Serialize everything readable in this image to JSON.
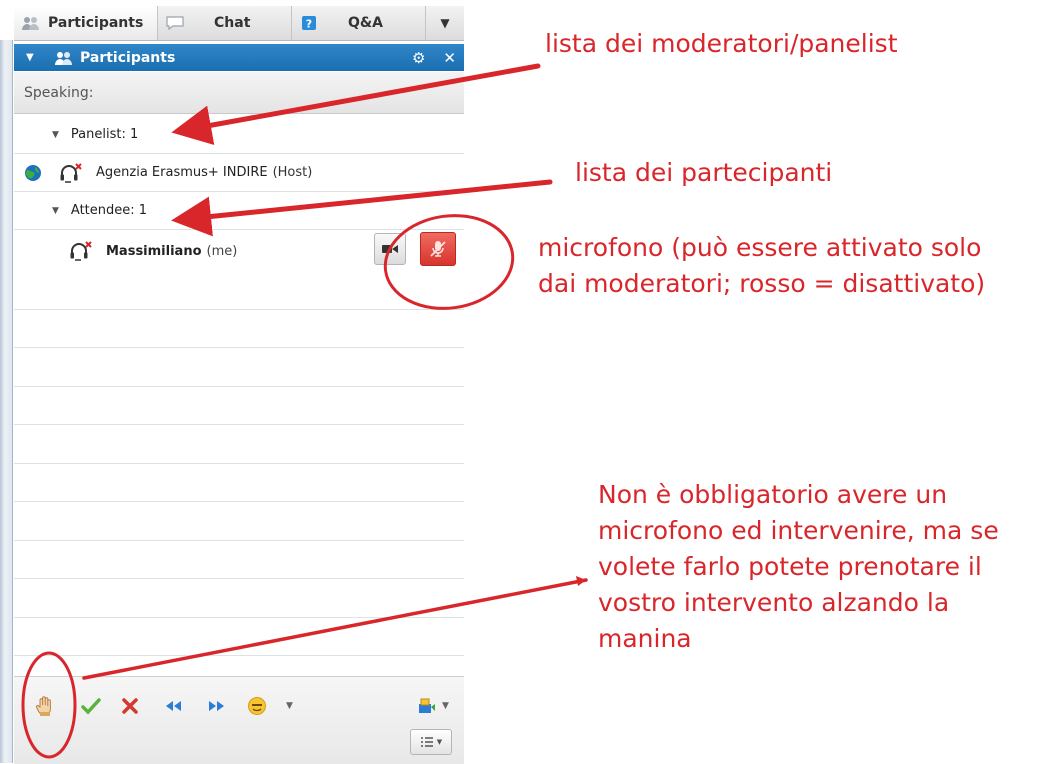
{
  "tabs": [
    {
      "label": "Participants",
      "icon": "participants-icon"
    },
    {
      "label": "Chat",
      "icon": "chat-bubble-icon"
    },
    {
      "label": "Q&A",
      "icon": "question-icon"
    }
  ],
  "panel": {
    "title": "Participants",
    "speaking_label": "Speaking:"
  },
  "groups": {
    "panelist": {
      "label": "Panelist: 1",
      "members": [
        {
          "name": "Agenzia Erasmus+ INDIRE",
          "role": "(Host)"
        }
      ]
    },
    "attendee": {
      "label": "Attendee: 1",
      "members": [
        {
          "name": "Massimiliano",
          "role": "(me)"
        }
      ]
    }
  },
  "toolbar_icons": [
    "raise-hand-icon",
    "check-icon",
    "cross-icon",
    "rewind-icon",
    "fast-forward-icon",
    "emoticon-icon",
    "share-icon",
    "list-options-icon"
  ],
  "annotations": {
    "moderators": "lista dei moderatori/panelist",
    "participants": "lista dei partecipanti",
    "microphone": "microfono (può essere attivato solo\ndai moderatori; rosso = disattivato)",
    "raise_hand": "Non è obbligatorio avere un\nmicrofono ed intervenire, ma se\nvolete farlo potete prenotare il\nvostro intervento alzando la\nmanina"
  },
  "colors": {
    "accent_blue": "#1b6fb0",
    "annotation_red": "#d9262b",
    "mic_muted_red": "#e2463f"
  }
}
